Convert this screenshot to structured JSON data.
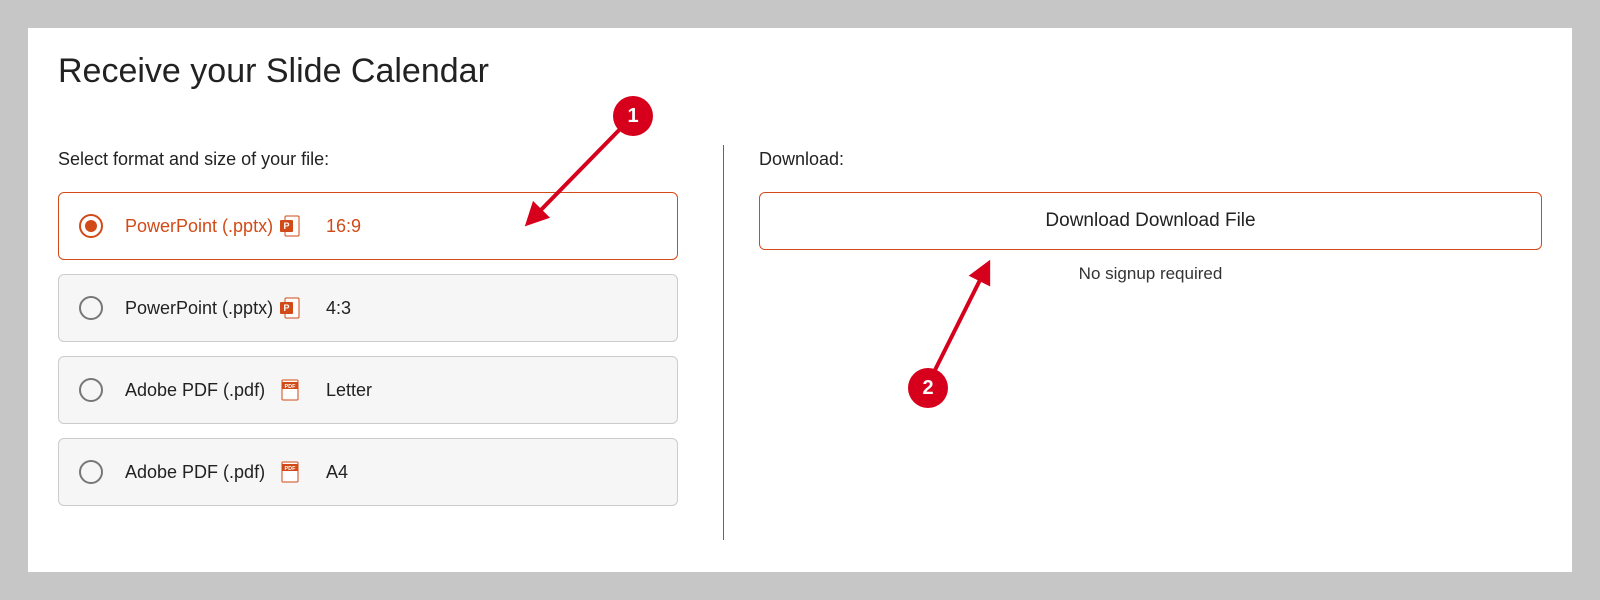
{
  "title": "Receive your Slide Calendar",
  "left": {
    "label": "Select format and size of your file:",
    "options": [
      {
        "label": "PowerPoint (.pptx)",
        "icon": "ppt",
        "size": "16:9",
        "selected": true
      },
      {
        "label": "PowerPoint (.pptx)",
        "icon": "ppt",
        "size": "4:3",
        "selected": false
      },
      {
        "label": "Adobe PDF (.pdf)",
        "icon": "pdf",
        "size": "Letter",
        "selected": false
      },
      {
        "label": "Adobe PDF (.pdf)",
        "icon": "pdf",
        "size": "A4",
        "selected": false
      }
    ]
  },
  "right": {
    "label": "Download:",
    "button": "Download Download File",
    "note": "No signup required"
  },
  "annotations": {
    "one": "1",
    "two": "2"
  }
}
